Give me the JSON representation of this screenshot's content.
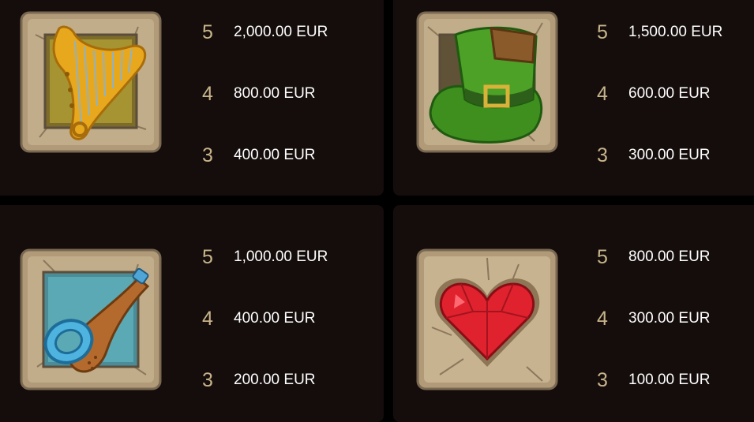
{
  "paytable": [
    {
      "symbol_icon": "golden-harp-icon",
      "payouts": [
        {
          "count": "5",
          "amount": "2,000.00 EUR"
        },
        {
          "count": "4",
          "amount": "800.00 EUR"
        },
        {
          "count": "3",
          "amount": "400.00 EUR"
        }
      ]
    },
    {
      "symbol_icon": "leprechaun-hat-icon",
      "payouts": [
        {
          "count": "5",
          "amount": "1,500.00 EUR"
        },
        {
          "count": "4",
          "amount": "600.00 EUR"
        },
        {
          "count": "3",
          "amount": "300.00 EUR"
        }
      ]
    },
    {
      "symbol_icon": "smoking-pipe-icon",
      "payouts": [
        {
          "count": "5",
          "amount": "1,000.00 EUR"
        },
        {
          "count": "4",
          "amount": "400.00 EUR"
        },
        {
          "count": "3",
          "amount": "200.00 EUR"
        }
      ]
    },
    {
      "symbol_icon": "red-heart-icon",
      "payouts": [
        {
          "count": "5",
          "amount": "800.00 EUR"
        },
        {
          "count": "4",
          "amount": "300.00 EUR"
        },
        {
          "count": "3",
          "amount": "100.00 EUR"
        }
      ]
    }
  ],
  "colors": {
    "background": "#000000",
    "panel": "#140d0c",
    "count_text": "#c8b48a",
    "amount_text": "#ffffff",
    "stone_frame": "#b59f7c"
  }
}
